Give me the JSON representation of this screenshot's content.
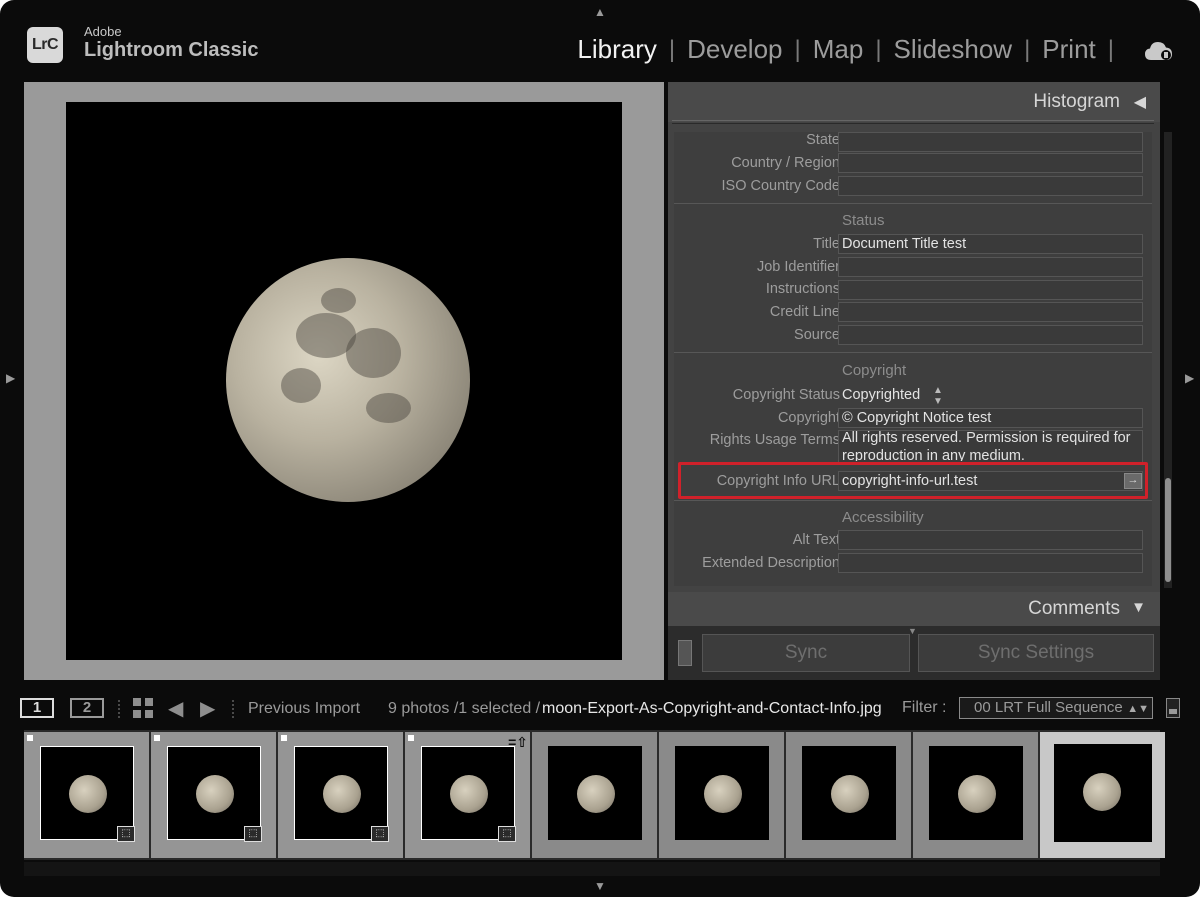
{
  "app": {
    "logo": "LrC",
    "vendor": "Adobe",
    "name": "Lightroom Classic"
  },
  "modules": [
    {
      "label": "Library",
      "active": true
    },
    {
      "label": "Develop",
      "active": false
    },
    {
      "label": "Map",
      "active": false
    },
    {
      "label": "Slideshow",
      "active": false
    },
    {
      "label": "Print",
      "active": false
    }
  ],
  "icons": {
    "cloud": "cloud-sync-icon",
    "grid": "grid-view-icon",
    "back": "arrow-left-icon",
    "forward": "arrow-right-icon"
  },
  "right_panel": {
    "histogram_title": "Histogram",
    "comments_title": "Comments",
    "location_rows": [
      {
        "label": "State",
        "value": ""
      },
      {
        "label": "Country / Region",
        "value": ""
      },
      {
        "label": "ISO Country Code",
        "value": ""
      }
    ],
    "status_section": {
      "title": "Status",
      "rows": [
        {
          "label": "Title",
          "value": "Document Title test"
        },
        {
          "label": "Job Identifier",
          "value": ""
        },
        {
          "label": "Instructions",
          "value": ""
        },
        {
          "label": "Credit Line",
          "value": ""
        },
        {
          "label": "Source",
          "value": ""
        }
      ]
    },
    "copyright_section": {
      "title": "Copyright",
      "status_label": "Copyright Status",
      "status_value": "Copyrighted",
      "copyright_label": "Copyright",
      "copyright_value": "© Copyright Notice test",
      "rights_label": "Rights Usage Terms",
      "rights_value": "All rights reserved. Permission is required for reproduction in any medium.",
      "url_label": "Copyright Info URL",
      "url_value": "copyright-info-url.test",
      "url_button": "→"
    },
    "accessibility_section": {
      "title": "Accessibility",
      "rows": [
        {
          "label": "Alt Text",
          "value": ""
        },
        {
          "label": "Extended Description",
          "value": ""
        }
      ]
    },
    "sync_label": "Sync",
    "sync_settings_label": "Sync Settings",
    "highlight_color": "#d0212a"
  },
  "toolbar": {
    "view1": "1",
    "view2": "2",
    "source": "Previous Import",
    "count": "9 photos /1 selected /",
    "filename": "moon-Export-As-Copyright-and-Contact-Info.jpg",
    "filter_label": "Filter :",
    "filter_value": "00 LRT Full Sequence"
  },
  "filmstrip": [
    {
      "flag": true,
      "badge": true,
      "pick": false,
      "style": "normal"
    },
    {
      "flag": true,
      "badge": true,
      "pick": false,
      "style": "normal"
    },
    {
      "flag": true,
      "badge": true,
      "pick": false,
      "style": "normal"
    },
    {
      "flag": true,
      "badge": true,
      "pick": true,
      "style": "normal"
    },
    {
      "flag": false,
      "badge": false,
      "pick": false,
      "style": "dim"
    },
    {
      "flag": false,
      "badge": false,
      "pick": false,
      "style": "dim"
    },
    {
      "flag": false,
      "badge": false,
      "pick": false,
      "style": "dim"
    },
    {
      "flag": false,
      "badge": false,
      "pick": false,
      "style": "dim"
    },
    {
      "flag": false,
      "badge": false,
      "pick": false,
      "style": "sel"
    }
  ]
}
